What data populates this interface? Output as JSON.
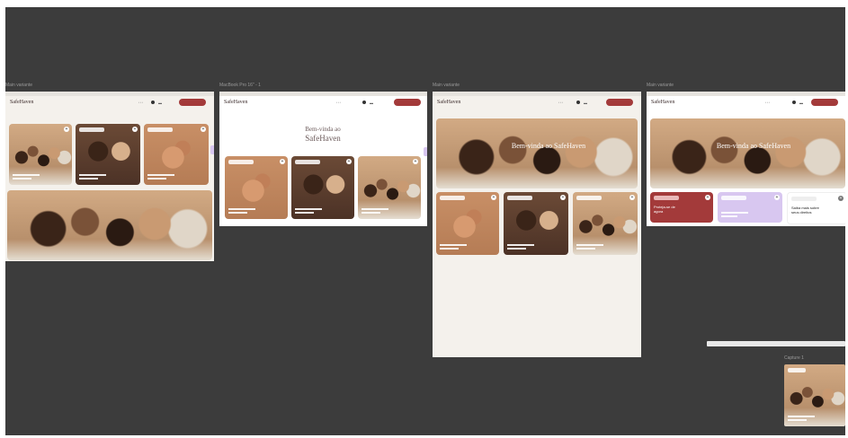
{
  "canvas": {
    "background": "#3c3c3c"
  },
  "frames": [
    {
      "label": "Main variante"
    },
    {
      "label": "MacBook Pro 16\" - 1"
    },
    {
      "label": "Main variante"
    },
    {
      "label": "Main variante"
    },
    {
      "label": "Capture 1"
    }
  ],
  "site": {
    "logo": "SafeHaven",
    "hero_line1": "Bem-vinda ao",
    "hero_line2": "SafeHaven",
    "hero_overlay": "Bem-vinda ao SafeHaven",
    "card_red_text_1": "Proteja-se de",
    "card_red_text_2": "agora",
    "card_white_text_1": "Saiba mais sobre",
    "card_white_text_2": "seus direitos"
  },
  "colors": {
    "accent": "#a33a3a",
    "lavender": "#d8c7f0",
    "frame_bg": "#f4f1ec"
  },
  "icons": [
    "plus-icon",
    "avatar-icon",
    "search-icon"
  ]
}
